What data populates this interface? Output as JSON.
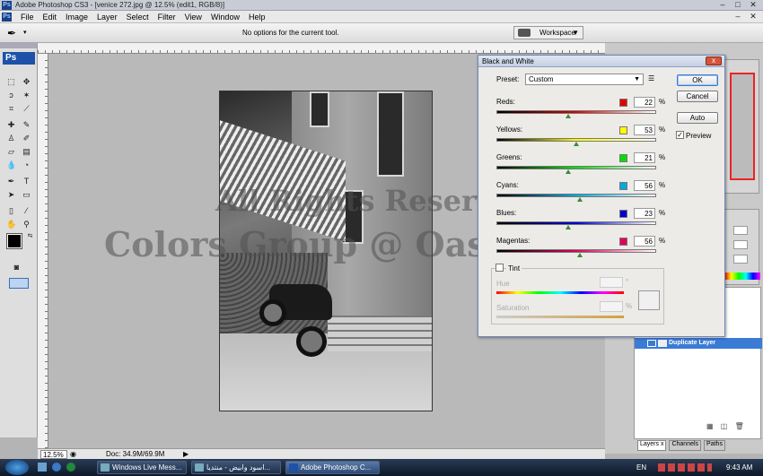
{
  "window": {
    "title": "Adobe Photoshop CS3 - [venice 272.jpg @ 12.5% (edit1, RGB/8)]",
    "app_icon": "Ps"
  },
  "menu": {
    "items": [
      "File",
      "Edit",
      "Image",
      "Layer",
      "Select",
      "Filter",
      "View",
      "Window",
      "Help"
    ]
  },
  "options_bar": {
    "message": "No options for the current tool.",
    "workspace_label": "Workspace"
  },
  "toolbox": {
    "logo": "Ps"
  },
  "canvas": {
    "watermark_line1": "All Rights Reserved to",
    "watermark_line2": "Colors Group @ Oasis.biz dubai.com"
  },
  "status": {
    "zoom": "12.5%",
    "doc": "Doc: 34.9M/69.9M"
  },
  "dialog": {
    "title": "Black and White",
    "close": "x",
    "preset_label": "Preset:",
    "preset_value": "Custom",
    "buttons": {
      "ok": "OK",
      "cancel": "Cancel",
      "auto": "Auto"
    },
    "preview": {
      "label": "Preview",
      "checked": true
    },
    "percent": "%",
    "sliders": [
      {
        "label": "Reds:",
        "value": "22",
        "color": "#e00000"
      },
      {
        "label": "Yellows:",
        "value": "53",
        "color": "#ffff00"
      },
      {
        "label": "Greens:",
        "value": "21",
        "color": "#00e000"
      },
      {
        "label": "Cyans:",
        "value": "56",
        "color": "#00a8e0"
      },
      {
        "label": "Blues:",
        "value": "23",
        "color": "#0000d0"
      },
      {
        "label": "Magentas:",
        "value": "56",
        "color": "#e0005a"
      }
    ],
    "tint": {
      "label": "Tint",
      "hue_label": "Hue",
      "saturation_label": "Saturation",
      "degree": "°",
      "percent": "%"
    }
  },
  "panels": {
    "layer_name": "Duplicate Layer",
    "tabs": [
      "Layers",
      "Channels",
      "Paths"
    ],
    "tab_close": "x"
  },
  "taskbar": {
    "items": [
      "Windows Live Mess...",
      "اسود وابيض - منتديا...",
      "Adobe Photoshop C..."
    ],
    "language": "EN",
    "time": "9:43 AM"
  }
}
